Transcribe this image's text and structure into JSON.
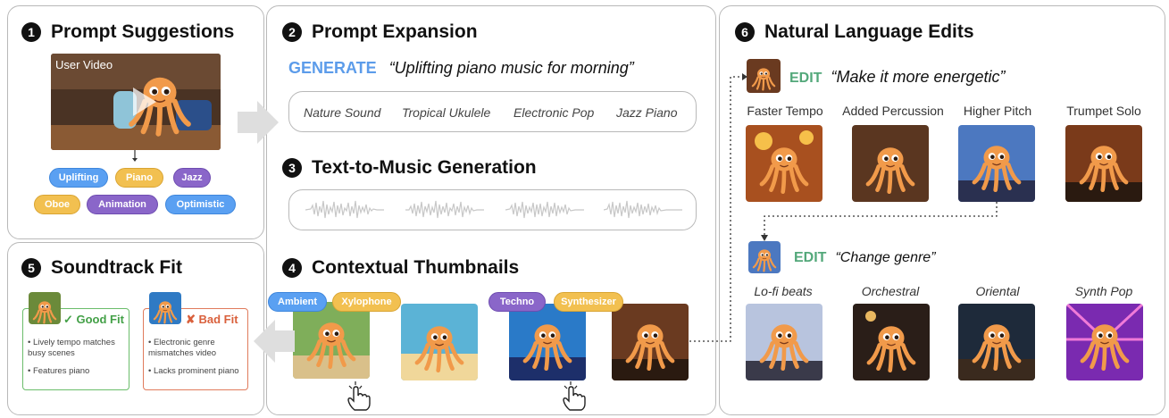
{
  "panel1": {
    "number": "1",
    "title": "Prompt Suggestions",
    "video_label": "User Video",
    "tags": [
      {
        "label": "Uplifting",
        "color": "blue"
      },
      {
        "label": "Piano",
        "color": "yellow"
      },
      {
        "label": "Jazz",
        "color": "purple"
      },
      {
        "label": "Oboe",
        "color": "yellow"
      },
      {
        "label": "Animation",
        "color": "purple"
      },
      {
        "label": "Optimistic",
        "color": "blue"
      }
    ]
  },
  "panel2": {
    "number": "2",
    "title": "Prompt Expansion",
    "keyword": "GENERATE",
    "prompt": "“Uplifting piano music for morning”",
    "suggestions": [
      "Nature Sound",
      "Tropical Ukulele",
      "Electronic Pop",
      "Jazz Piano"
    ]
  },
  "panel3": {
    "number": "3",
    "title": "Text-to-Music Generation"
  },
  "panel4": {
    "number": "4",
    "title": "Contextual Thumbnails",
    "tags": [
      {
        "label": "Ambient",
        "color": "blue"
      },
      {
        "label": "Xylophone",
        "color": "yellow"
      },
      {
        "label": "Techno",
        "color": "purple"
      },
      {
        "label": "Synthesizer",
        "color": "yellow"
      }
    ]
  },
  "panel5": {
    "number": "5",
    "title": "Soundtrack Fit",
    "good": {
      "label": "✓ Good Fit",
      "bullets": [
        "Lively tempo matches busy scenes",
        "Features piano"
      ]
    },
    "bad": {
      "label": "✘ Bad Fit",
      "bullets": [
        "Electronic genre mismatches video",
        "Lacks prominent piano"
      ]
    }
  },
  "panel6": {
    "number": "6",
    "title": "Natural Language Edits",
    "edit1": {
      "keyword": "EDIT",
      "prompt": "“Make it more energetic”",
      "variants": [
        "Faster Tempo",
        "Added Percussion",
        "Higher Pitch",
        "Trumpet Solo"
      ]
    },
    "edit2": {
      "keyword": "EDIT",
      "prompt": "“Change genre”",
      "variants": [
        "Lo-fi beats",
        "Orchestral",
        "Oriental",
        "Synth Pop"
      ]
    }
  },
  "colors": {
    "blue_tag": "#5aa0f2",
    "yellow_tag": "#f2c050",
    "purple_tag": "#8a66c9",
    "generate": "#5c9cea",
    "edit": "#53a87a",
    "good_fit": "#43a047",
    "bad_fit": "#d9603c"
  }
}
